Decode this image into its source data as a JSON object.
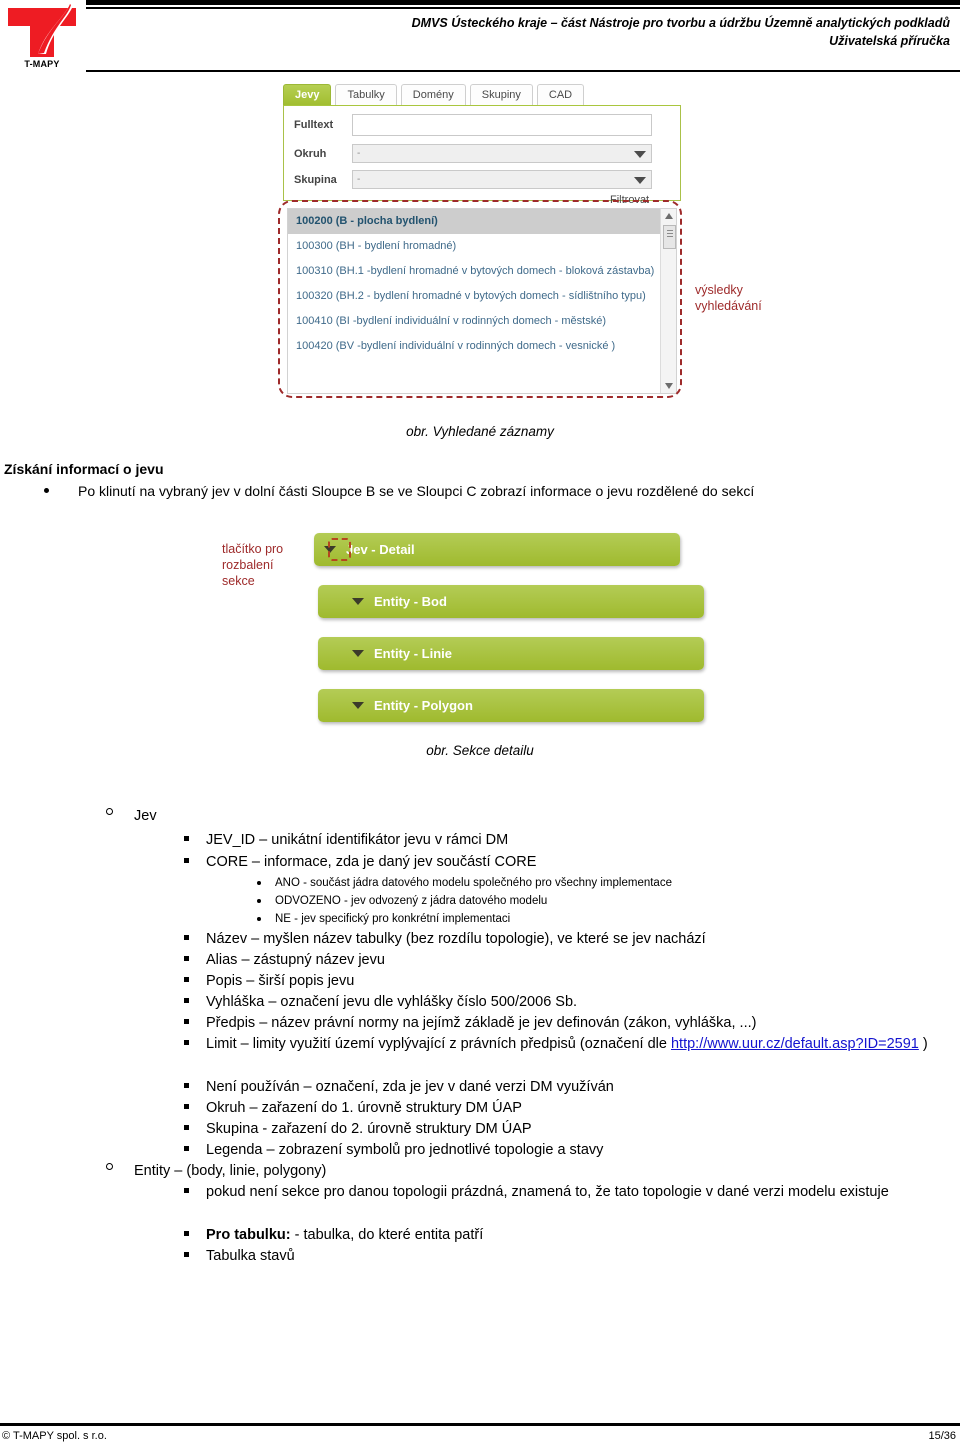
{
  "header": {
    "logo_text": "T-MAPY",
    "title_line1": "DMVS Ústeckého kraje – část Nástroje pro tvorbu a údržbu Územně analytických podkladů",
    "title_line2": "Uživatelská příručka"
  },
  "screenshot_search": {
    "tabs": [
      {
        "label": "Jevy",
        "active": true
      },
      {
        "label": "Tabulky",
        "active": false
      },
      {
        "label": "Domény",
        "active": false
      },
      {
        "label": "Skupiny",
        "active": false
      },
      {
        "label": "CAD",
        "active": false
      }
    ],
    "fields": {
      "fulltext_label": "Fulltext",
      "fulltext_value": "",
      "okruh_label": "Okruh",
      "okruh_value": "-",
      "skupina_label": "Skupina",
      "skupina_value": "-"
    },
    "filter_button": "Filtrovat",
    "results": [
      "100200 (B - plocha bydlení)",
      "100300 (BH - bydlení hromadné)",
      "100310 (BH.1 -bydlení hromadné v bytových domech - bloková zástavba)",
      "100320 (BH.2 - bydlení hromadné v bytových domech - sídlištního typu)",
      "100410 (BI -bydlení individuální v rodinných domech - městské)",
      "100420 (BV -bydlení individuální v rodinných domech - vesnické )"
    ],
    "annotation": "výsledky\nvyhledávání",
    "caption": "obr. Vyhledané záznamy",
    "accent_green": "#a9c63e",
    "annotation_color": "#9e2a2a"
  },
  "section": {
    "heading": "Získání informací o jevu",
    "intro_bullet": "Po klinutí na vybraný jev v dolní části Sloupce B se ve Sloupci C zobrazí informace o jevu rozdělené do sekcí"
  },
  "screenshot_detail": {
    "annotation": "tlačítko pro\nrozbalení\nsekce",
    "bars": [
      "Jev - Detail",
      "Entity - Bod",
      "Entity - Linie",
      "Entity - Polygon"
    ],
    "caption": "obr. Sekce detailu",
    "bar_color": "#a9c63e"
  },
  "outline": {
    "jev": {
      "label": "Jev",
      "items": [
        {
          "text": "JEV_ID – unikátní identifikátor jevu v rámci DM"
        },
        {
          "text": "CORE – informace, zda je daný jev součástí CORE",
          "subitems": [
            "ANO - součást jádra datového modelu společného pro všechny implementace",
            "ODVOZENO - jev odvozený z jádra datového modelu",
            "NE - jev specifický pro konkrétní implementaci"
          ]
        },
        {
          "text": "Název – myšlen název tabulky (bez rozdílu topologie), ve které se jev nachází"
        },
        {
          "text": "Alias – zástupný název jevu"
        },
        {
          "text": "Popis – širší popis jevu"
        },
        {
          "text": "Vyhláška – označení jevu dle vyhlášky číslo 500/2006 Sb."
        },
        {
          "text": "Předpis – název právní normy na jejímž základě je jev definován (zákon, vyhláška, ...)"
        },
        {
          "text": "Limit – limity využití území vyplývající z právních předpisů (označení dle ",
          "link": "http://www.uur.cz/default.asp?ID=2591",
          "text_after": " )"
        },
        {
          "text": "Není používán – označení, zda je jev v dané verzi DM využíván"
        },
        {
          "text": "Okruh – zařazení do 1. úrovně struktury DM ÚAP"
        },
        {
          "text": "Skupina - zařazení do 2. úrovně struktury DM ÚAP"
        },
        {
          "text": "Legenda – zobrazení symbolů pro jednotlivé topologie a stavy"
        }
      ]
    },
    "entity": {
      "label": "Entity – (body, linie, polygony)",
      "items": [
        {
          "text": "pokud není sekce pro danou topologii prázdná, znamená to, že tato topologie v dané verzi modelu existuje"
        },
        {
          "bold": "Pro tabulku:",
          "text": " - tabulka, do které entita patří"
        },
        {
          "text": "Tabulka stavů"
        }
      ]
    }
  },
  "footer": {
    "left": "© T-MAPY spol. s r.o.",
    "right": "15/36"
  }
}
